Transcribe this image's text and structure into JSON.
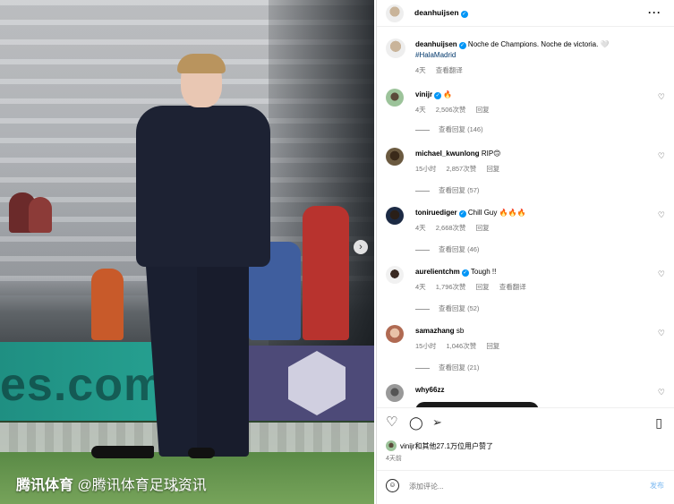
{
  "post": {
    "watermark_brand": "腾讯体育",
    "watermark_handle": "@腾讯体育足球资讯",
    "board_text": "es.com",
    "next_icon": "›"
  },
  "header": {
    "username": "deanhuijsen",
    "more_icon": "···"
  },
  "caption": {
    "username": "deanhuijsen",
    "text": "Noche de Champions. Noche de victoria. 🤍",
    "hashtag": "#HalaMadrid",
    "time": "4天",
    "translate": "查看翻译"
  },
  "comments": [
    {
      "username": "vinijr",
      "verified": true,
      "text": "🔥",
      "time": "4天",
      "likes": "2,506次赞",
      "reply": "回复",
      "replies": "查看回复 (146)"
    },
    {
      "username": "michael_kwunlong",
      "verified": false,
      "text": "RIP🙃",
      "time": "15小时",
      "likes": "2,857次赞",
      "reply": "回复",
      "replies": "查看回复 (57)"
    },
    {
      "username": "toniruediger",
      "verified": true,
      "text": "Chill Guy 🔥🔥🔥",
      "time": "4天",
      "likes": "2,668次赞",
      "reply": "回复",
      "replies": "查看回复 (46)"
    },
    {
      "username": "aurelientchm",
      "verified": true,
      "text": "Tough !!",
      "time": "4天",
      "likes": "1,796次赞",
      "reply": "回复",
      "translate": "查看翻译",
      "replies": "查看回复 (52)"
    },
    {
      "username": "samazhang",
      "verified": false,
      "text": "sb",
      "time": "15小时",
      "likes": "1,046次赞",
      "reply": "回复",
      "replies": "查看回复 (21)"
    },
    {
      "username": "why66zz",
      "verified": false,
      "text": ""
    }
  ],
  "actions": {
    "like_icon": "♡",
    "comment_icon": "◯",
    "share_icon": "➢",
    "save_icon": "▯",
    "liked_by": "vinijr和其他27.1万位用户赞了",
    "posted_ago": "4天前"
  },
  "composer": {
    "emoji_icon": "☺",
    "placeholder": "添加评论...",
    "post_label": "发布"
  },
  "colors": {
    "verified": "#0095f6",
    "link": "#00376b",
    "muted": "#737373",
    "post_button": "#7ab8f1"
  }
}
